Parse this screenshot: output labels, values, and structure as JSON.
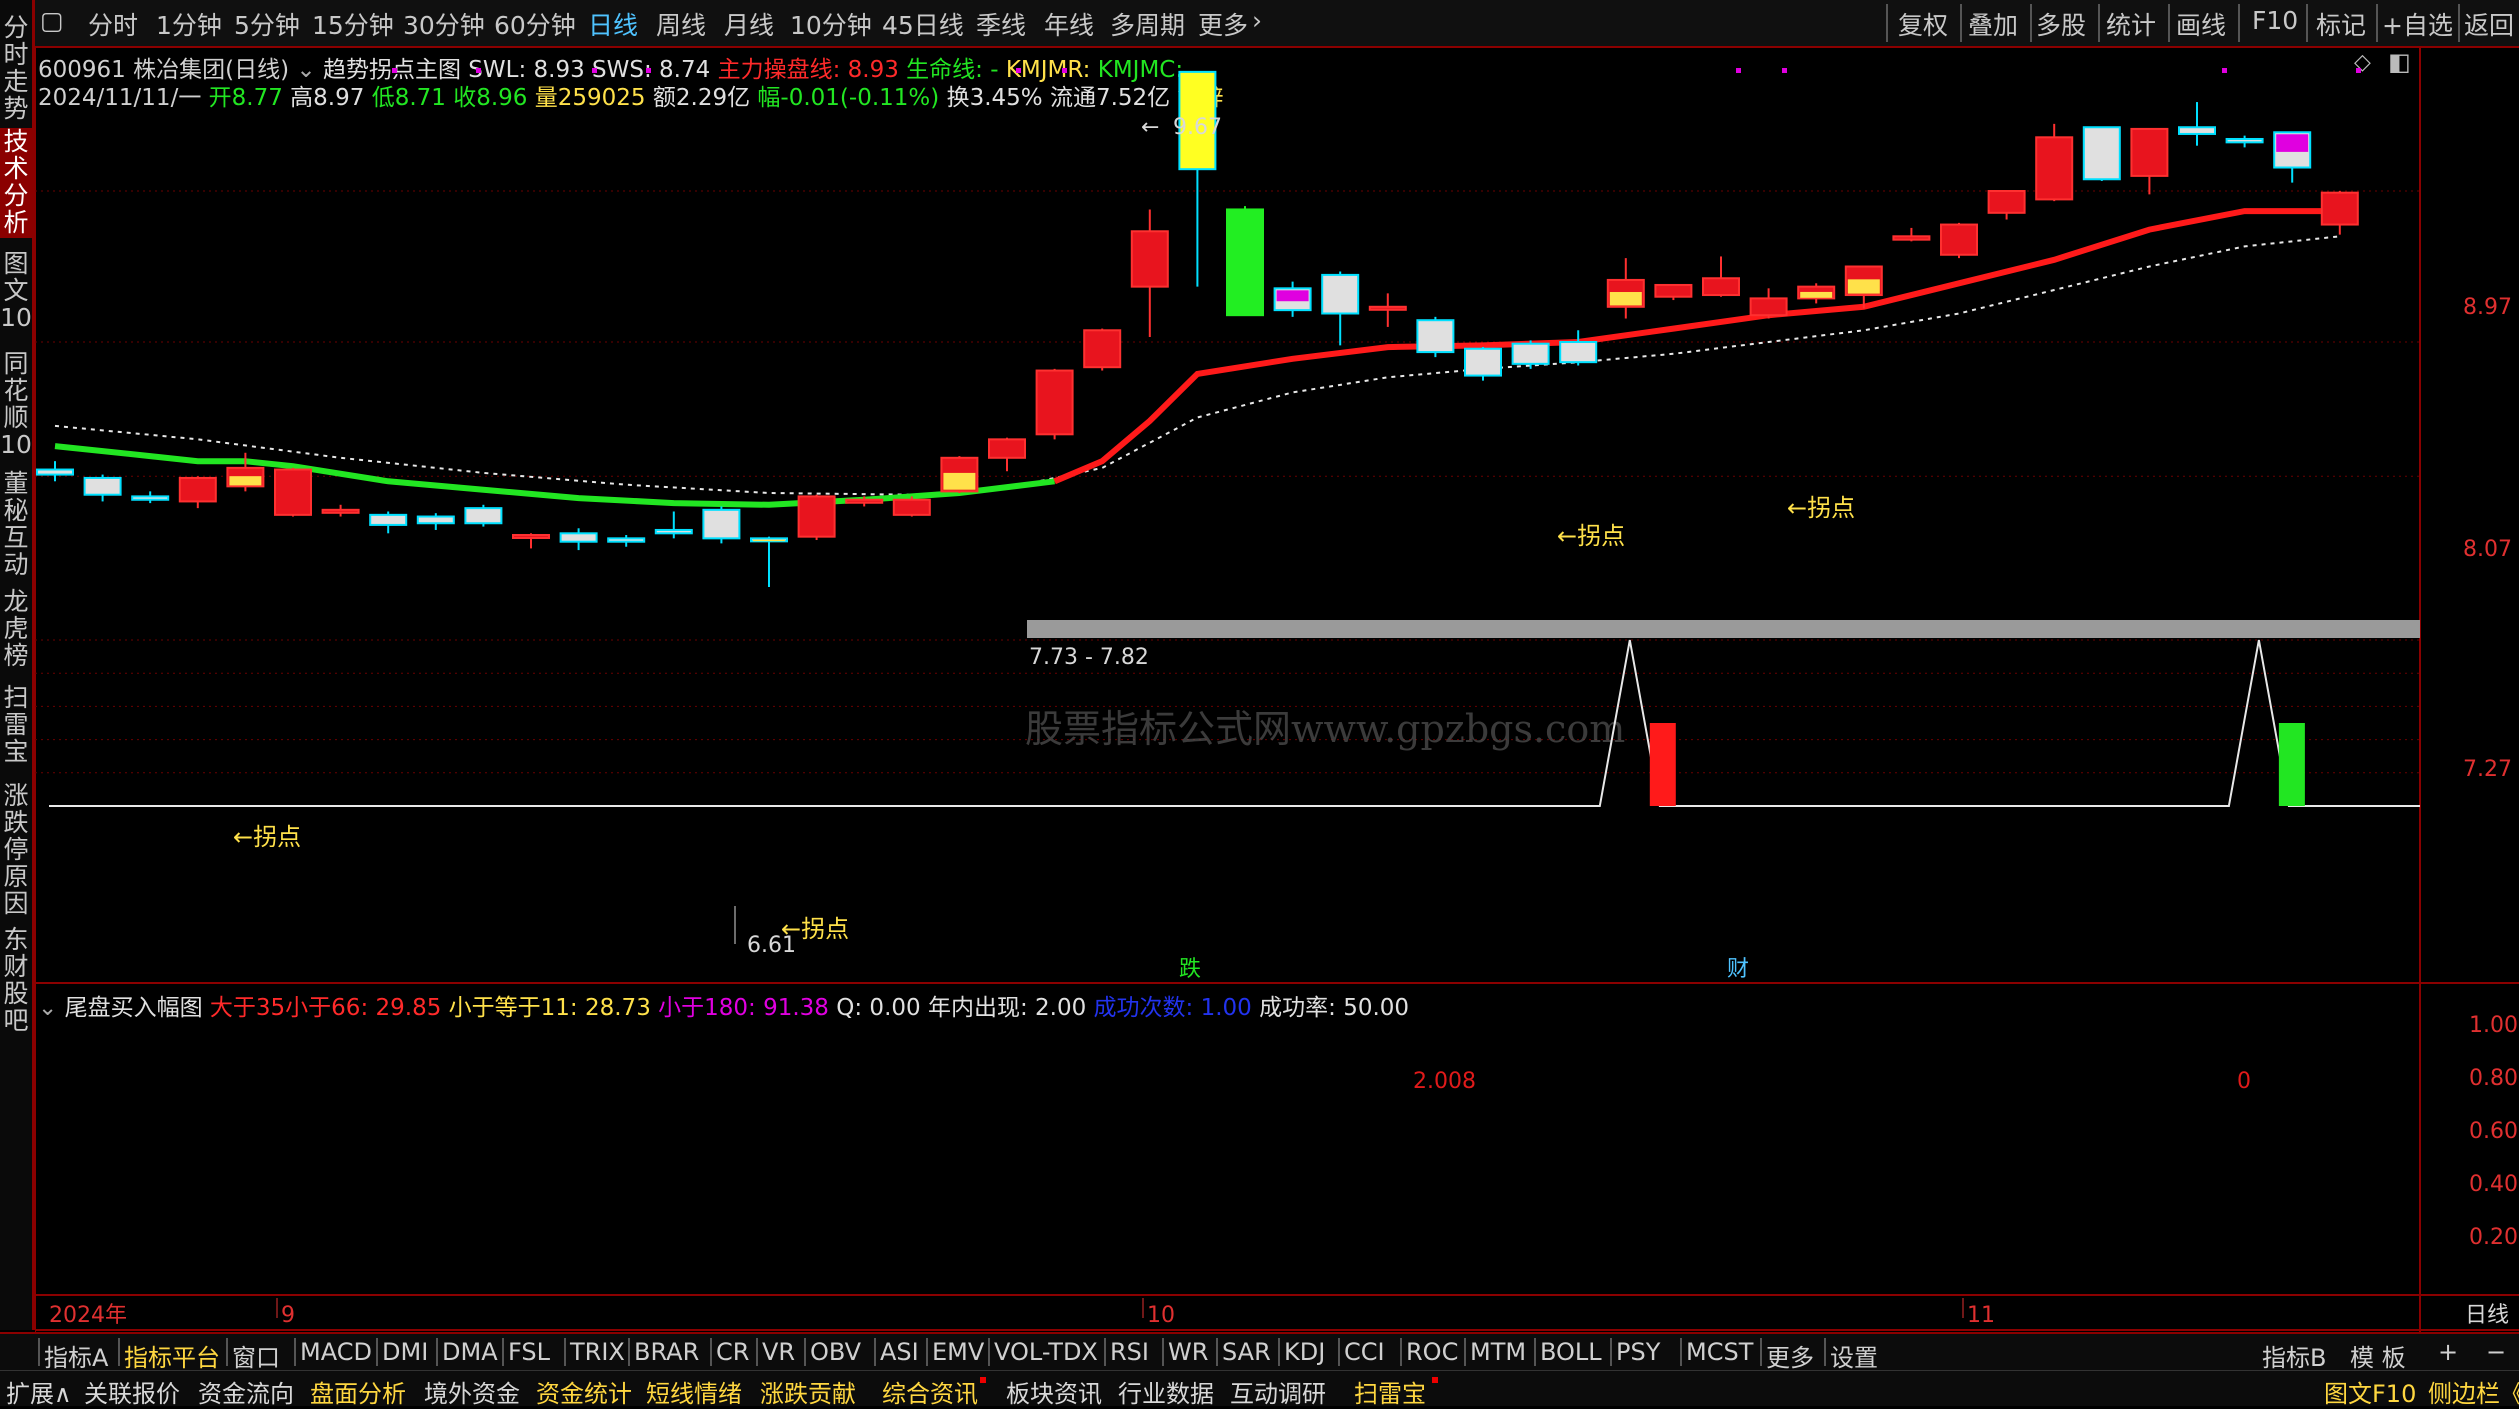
{
  "top_menu": {
    "periods": [
      "分时",
      "1分钟",
      "5分钟",
      "15分钟",
      "30分钟",
      "60分钟",
      "日线",
      "周线",
      "月线",
      "10分钟",
      "45日线",
      "季线",
      "年线",
      "多周期",
      "更多"
    ],
    "active_period": "日线",
    "right_items": [
      "复权",
      "叠加",
      "多股",
      "统计",
      "画线",
      "F10",
      "标记",
      "+自选",
      "返回"
    ]
  },
  "sidebar": {
    "tabs": [
      "分时走势",
      "技术分析",
      "图文10",
      "同花顺10",
      "董秘互动",
      "龙虎榜",
      "扫雷宝",
      "涨跌停原因",
      "东财股吧"
    ],
    "active_tab": "技术分析"
  },
  "main_chart": {
    "stock_code": "600961",
    "stock_name": "株冶集团(日线)",
    "formula_name": "趋势拐点主图",
    "swl": "SWL: 8.93",
    "sws": "SWS: 8.74",
    "zlcpx": "主力操盘线: 8.93",
    "smx": "生命线: -",
    "kmjmr": "KMJMR:",
    "kmjmc": "KMJMC:",
    "bar_date": "2024/11/11/一",
    "open": "开8.77",
    "high": "高8.97",
    "low": "低8.71",
    "close": "收8.96",
    "volume": "量259025",
    "amount": "额2.29亿",
    "change": "幅-0.01(-0.11%)",
    "turnover": "换3.45%",
    "float": "流通7.52亿",
    "sector": "铅锌",
    "price_axis": [
      "8.97",
      "8.07",
      "7.27"
    ],
    "annot_high": "9.67",
    "annot_low": "6.61",
    "band_label": "7.73 - 7.82",
    "turning_label": "←拐点",
    "marker_die": "跌",
    "marker_cai": "财",
    "watermark": "股票指标公式网www.gpzbgs.com"
  },
  "sub_chart": {
    "title": "尾盘买入幅图",
    "v1": "大于35小于66: 29.85",
    "v2": "小于等于11: 28.73",
    "v3": "小于180: 91.38",
    "v4": "Q: 0.00",
    "v5": "年内出现: 2.00",
    "v6": "成功次数: 1.00",
    "v7": "成功率: 50.00",
    "axis": [
      "1.00",
      "0.80",
      "0.60",
      "0.40",
      "0.20"
    ],
    "label_a": "2.008",
    "label_b": "0"
  },
  "x_axis": {
    "labels": [
      "2024年",
      "9",
      "10",
      "11"
    ],
    "period": "日线"
  },
  "indicator_bar": {
    "items": [
      "指标A",
      "指标平台",
      "窗口",
      "MACD",
      "DMI",
      "DMA",
      "FSL",
      "TRIX",
      "BRAR",
      "CR",
      "VR",
      "OBV",
      "ASI",
      "EMV",
      "VOL-TDX",
      "RSI",
      "WR",
      "SAR",
      "KDJ",
      "CCI",
      "ROC",
      "MTM",
      "BOLL",
      "PSY",
      "MCST",
      "更多",
      "设置"
    ],
    "right": [
      "指标B",
      "模 板",
      "+",
      "−"
    ]
  },
  "func_bar": {
    "items": [
      "扩展∧",
      "关联报价",
      "资金流向",
      "盘面分析",
      "境外资金",
      "资金统计",
      "短线情绪",
      "涨跌贡献",
      "综合资讯",
      "板块资讯",
      "行业数据",
      "互动调研",
      "扫雷宝"
    ],
    "right": [
      "图文F10",
      "侧边栏《"
    ]
  },
  "colors": {
    "up": "#e8141e",
    "down": "#e8e8e8",
    "ma_green": "#22e622",
    "ma_red": "#ff1a1a",
    "accent_blue": "#4fc3ff",
    "yellow": "#ffe14a",
    "magenta": "#e000e0"
  },
  "chart_data": [
    {
      "type": "candlestick",
      "price_axis_ticks": [
        8.97,
        8.07,
        7.27
      ],
      "ylim": [
        6.4,
        9.9
      ],
      "x_labels": [
        "2024年",
        "9",
        "10",
        "11"
      ],
      "candles": [
        {
          "o": 7.31,
          "h": 7.36,
          "l": 7.24,
          "c": 7.28
        },
        {
          "o": 7.26,
          "h": 7.28,
          "l": 7.12,
          "c": 7.16
        },
        {
          "o": 7.15,
          "h": 7.18,
          "l": 7.11,
          "c": 7.13
        },
        {
          "o": 7.12,
          "h": 7.27,
          "l": 7.08,
          "c": 7.26
        },
        {
          "o": 7.21,
          "h": 7.41,
          "l": 7.18,
          "c": 7.32
        },
        {
          "o": 7.04,
          "h": 7.32,
          "l": 7.03,
          "c": 7.31
        },
        {
          "o": 7.06,
          "h": 7.1,
          "l": 7.03,
          "c": 7.07
        },
        {
          "o": 7.04,
          "h": 7.06,
          "l": 6.93,
          "c": 6.98
        },
        {
          "o": 7.03,
          "h": 7.05,
          "l": 6.95,
          "c": 6.99
        },
        {
          "o": 7.08,
          "h": 7.1,
          "l": 6.97,
          "c": 6.99
        },
        {
          "o": 6.91,
          "h": 6.93,
          "l": 6.84,
          "c": 6.92
        },
        {
          "o": 6.93,
          "h": 6.96,
          "l": 6.83,
          "c": 6.88
        },
        {
          "o": 6.9,
          "h": 6.92,
          "l": 6.85,
          "c": 6.88
        },
        {
          "o": 6.95,
          "h": 7.06,
          "l": 6.9,
          "c": 6.93
        },
        {
          "o": 7.07,
          "h": 7.09,
          "l": 6.87,
          "c": 6.9
        },
        {
          "o": 6.9,
          "h": 6.91,
          "l": 6.61,
          "c": 6.89
        },
        {
          "o": 6.91,
          "h": 7.16,
          "l": 6.89,
          "c": 7.15
        },
        {
          "o": 7.12,
          "h": 7.15,
          "l": 7.09,
          "c": 7.13
        },
        {
          "o": 7.04,
          "h": 7.15,
          "l": 7.03,
          "c": 7.13
        },
        {
          "o": 7.18,
          "h": 7.39,
          "l": 7.17,
          "c": 7.38
        },
        {
          "o": 7.38,
          "h": 7.5,
          "l": 7.3,
          "c": 7.49
        },
        {
          "o": 7.52,
          "h": 7.91,
          "l": 7.49,
          "c": 7.9
        },
        {
          "o": 7.92,
          "h": 8.15,
          "l": 7.9,
          "c": 8.14
        },
        {
          "o": 8.4,
          "h": 8.86,
          "l": 8.1,
          "c": 8.73
        },
        {
          "o": 9.1,
          "h": 9.67,
          "l": 8.4,
          "c": 9.68
        },
        {
          "o": 8.86,
          "h": 8.88,
          "l": 8.23,
          "c": 8.23
        },
        {
          "o": 8.39,
          "h": 8.43,
          "l": 8.22,
          "c": 8.26
        },
        {
          "o": 8.47,
          "h": 8.49,
          "l": 8.05,
          "c": 8.24
        },
        {
          "o": 8.27,
          "h": 8.36,
          "l": 8.16,
          "c": 8.28
        },
        {
          "o": 8.2,
          "h": 8.22,
          "l": 7.98,
          "c": 8.01
        },
        {
          "o": 8.03,
          "h": 8.04,
          "l": 7.84,
          "c": 7.87
        },
        {
          "o": 8.06,
          "h": 8.08,
          "l": 7.91,
          "c": 7.94
        },
        {
          "o": 8.07,
          "h": 8.14,
          "l": 7.93,
          "c": 7.95
        },
        {
          "o": 8.28,
          "h": 8.57,
          "l": 8.21,
          "c": 8.44
        },
        {
          "o": 8.34,
          "h": 8.38,
          "l": 8.32,
          "c": 8.41
        },
        {
          "o": 8.35,
          "h": 8.58,
          "l": 8.34,
          "c": 8.45
        },
        {
          "o": 8.23,
          "h": 8.39,
          "l": 8.21,
          "c": 8.33
        },
        {
          "o": 8.33,
          "h": 8.42,
          "l": 8.3,
          "c": 8.4
        },
        {
          "o": 8.35,
          "h": 8.48,
          "l": 8.27,
          "c": 8.52
        },
        {
          "o": 8.68,
          "h": 8.75,
          "l": 8.67,
          "c": 8.7
        },
        {
          "o": 8.59,
          "h": 8.78,
          "l": 8.57,
          "c": 8.77
        },
        {
          "o": 8.84,
          "h": 8.85,
          "l": 8.8,
          "c": 8.97
        },
        {
          "o": 8.92,
          "h": 9.37,
          "l": 8.91,
          "c": 9.29
        },
        {
          "o": 9.35,
          "h": 9.31,
          "l": 9.03,
          "c": 9.04
        },
        {
          "o": 9.06,
          "h": 9.34,
          "l": 8.95,
          "c": 9.34
        },
        {
          "o": 9.35,
          "h": 9.5,
          "l": 9.24,
          "c": 9.31
        },
        {
          "o": 9.28,
          "h": 9.3,
          "l": 9.23,
          "c": 9.26
        },
        {
          "o": 9.32,
          "h": 9.04,
          "l": 9.02,
          "c": 9.11
        },
        {
          "o": 8.77,
          "h": 8.97,
          "l": 8.71,
          "c": 8.96
        }
      ]
    },
    {
      "type": "line",
      "panel": "尾盘买入幅图",
      "ylim": [
        0,
        1.0
      ],
      "axis_ticks": [
        1.0,
        0.8,
        0.6,
        0.4,
        0.2
      ],
      "peaks_at_candle_index": [
        33,
        47
      ],
      "bars": [
        {
          "index": 34,
          "value": 0.5,
          "color": "red"
        },
        {
          "index": 48,
          "value": 0.5,
          "color": "green"
        }
      ]
    }
  ]
}
